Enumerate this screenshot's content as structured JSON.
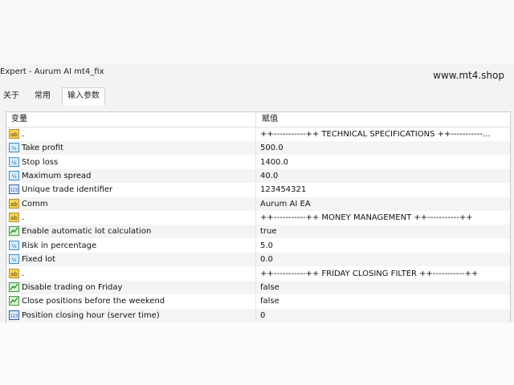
{
  "window": {
    "title": "Expert - Aurum AI mt4_fix",
    "watermark": "www.mt4.shop"
  },
  "tabs": [
    {
      "label": "关于",
      "active": false
    },
    {
      "label": "常用",
      "active": false
    },
    {
      "label": "输入参数",
      "active": true
    }
  ],
  "columns": {
    "variable": "变量",
    "value": "赋值"
  },
  "rows": [
    {
      "type": "ab",
      "name": ".",
      "value": "++-----------++    TECHNICAL SPECIFICATIONS    ++-----------..."
    },
    {
      "type": "v2",
      "name": "Take profit",
      "value": "500.0"
    },
    {
      "type": "v2",
      "name": "Stop loss",
      "value": "1400.0"
    },
    {
      "type": "v2",
      "name": "Maximum spread",
      "value": "40.0"
    },
    {
      "type": "n123",
      "name": "Unique trade identifier",
      "value": "123454321"
    },
    {
      "type": "ab",
      "name": "Comm",
      "value": "Aurum AI EA"
    },
    {
      "type": "ab",
      "name": ".",
      "value": "++-----------++    MONEY MANAGEMENT    ++-----------++"
    },
    {
      "type": "bool",
      "name": "Enable automatic lot calculation",
      "value": "true"
    },
    {
      "type": "v2",
      "name": "Risk in percentage",
      "value": "5.0"
    },
    {
      "type": "v2",
      "name": "Fixed lot",
      "value": "0.0"
    },
    {
      "type": "ab",
      "name": ".",
      "value": "++-----------++    FRIDAY CLOSING FILTER    ++-----------++"
    },
    {
      "type": "bool",
      "name": "Disable trading on Friday",
      "value": "false"
    },
    {
      "type": "bool",
      "name": "Close positions before the weekend",
      "value": "false"
    },
    {
      "type": "n123",
      "name": "Position closing hour (server time)",
      "value": "0"
    }
  ],
  "icon_names": {
    "ab": "string-param-icon",
    "v2": "double-param-icon",
    "n123": "integer-param-icon",
    "bool": "bool-param-icon"
  }
}
